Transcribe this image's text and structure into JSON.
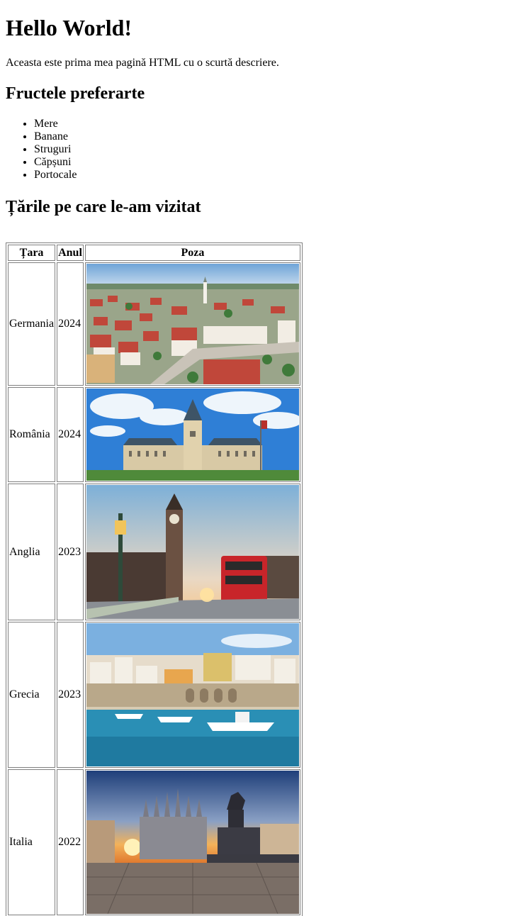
{
  "heading": "Hello World!",
  "description": "Aceasta este prima mea pagină HTML cu o scurtă descriere.",
  "fruits": {
    "title": "Fructele preferarte",
    "items": [
      "Mere",
      "Banane",
      "Struguri",
      "Căpșuni",
      "Portocale"
    ]
  },
  "countries": {
    "title": "Țările pe care le-am vizitat",
    "headers": {
      "country": "Țara",
      "year": "Anul",
      "photo": "Poza"
    },
    "rows": [
      {
        "country": "Germania",
        "year": "2024"
      },
      {
        "country": "România",
        "year": "2024"
      },
      {
        "country": "Anglia",
        "year": "2023"
      },
      {
        "country": "Grecia",
        "year": "2023"
      },
      {
        "country": "Italia",
        "year": "2022"
      }
    ]
  },
  "colors": {
    "border": "#808080",
    "sky": "#7fb3e6",
    "roof": "#c0473a",
    "grass": "#5a9b3c"
  }
}
